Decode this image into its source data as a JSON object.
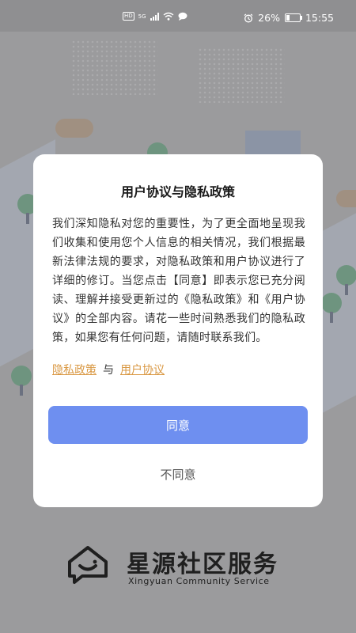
{
  "status_bar": {
    "network_badge": "HD",
    "network_type": "5G",
    "battery_percent": "26%",
    "battery_level": 0.26,
    "time": "15:55"
  },
  "dialog": {
    "title": "用户协议与隐私政策",
    "body": "我们深知隐私对您的重要性，为了更全面地呈现我们收集和使用您个人信息的相关情况，我们根据最新法律法规的要求，对隐私政策和用户协议进行了详细的修订。当您点击【同意】即表示您已充分阅读、理解并接受更新过的《隐私政策》和《用户协议》的全部内容。请花一些时间熟悉我们的隐私政策，如果您有任何问题，请随时联系我们。",
    "privacy_link": "隐私政策",
    "link_separator": "与",
    "agreement_link": "用户协议",
    "agree_label": "同意",
    "disagree_label": "不同意"
  },
  "brand": {
    "name": "星源社区服务",
    "subtitle": "Xingyuan Community Service"
  },
  "colors": {
    "accent": "#6e8ff0",
    "link": "#d99843",
    "overlay": "#9b9b9d"
  }
}
